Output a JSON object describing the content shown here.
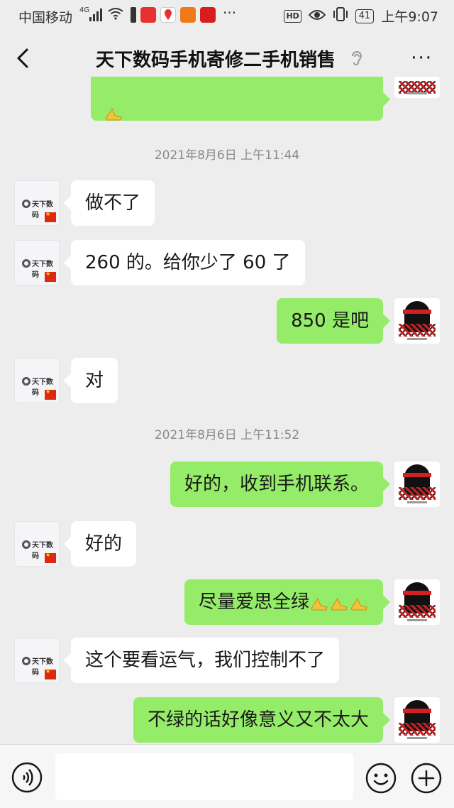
{
  "status_bar": {
    "carrier": "中国移动",
    "network": "4G",
    "hd_label": "HD",
    "battery": "41",
    "time": "上午9:07"
  },
  "header": {
    "title": "天下数码手机寄修二手机销售",
    "menu": "···"
  },
  "avatars": {
    "shop_brand": "天下数码"
  },
  "timestamps": [
    "2021年8月6日 上午11:44",
    "2021年8月6日 上午11:52"
  ],
  "messages": [
    {
      "side": "out",
      "text": ""
    },
    {
      "side": "in",
      "text": "做不了"
    },
    {
      "side": "in",
      "text": "260 的。给你少了 60 了"
    },
    {
      "side": "out",
      "text": "850 是吧"
    },
    {
      "side": "in",
      "text": "对"
    },
    {
      "side": "out",
      "text": "好的，收到手机联系。"
    },
    {
      "side": "in",
      "text": "好的"
    },
    {
      "side": "out",
      "text": "尽量爱思全绿"
    },
    {
      "side": "in",
      "text": "这个要看运气，我们控制不了"
    },
    {
      "side": "out",
      "text": "不绿的话好像意义又不太大"
    }
  ],
  "icons": {
    "back": "chevron-left-icon",
    "ear": "ear-icon",
    "voice": "voice-icon",
    "emoji": "smiley-icon",
    "plus": "plus-circle-icon",
    "hands": "folded-hands-emoji"
  },
  "colors": {
    "background": "#ededed",
    "outgoing_bubble": "#95ec69",
    "incoming_bubble": "#ffffff",
    "timestamp": "#8a8a8a"
  }
}
